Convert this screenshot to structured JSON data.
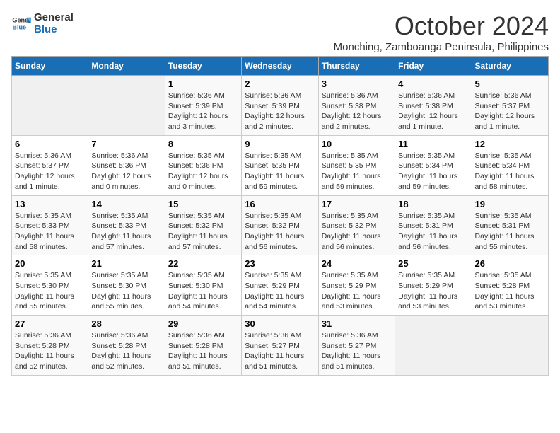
{
  "logo": {
    "line1": "General",
    "line2": "Blue"
  },
  "title": "October 2024",
  "subtitle": "Monching, Zamboanga Peninsula, Philippines",
  "days_of_week": [
    "Sunday",
    "Monday",
    "Tuesday",
    "Wednesday",
    "Thursday",
    "Friday",
    "Saturday"
  ],
  "weeks": [
    [
      {
        "day": "",
        "sunrise": "",
        "sunset": "",
        "daylight": ""
      },
      {
        "day": "",
        "sunrise": "",
        "sunset": "",
        "daylight": ""
      },
      {
        "day": "1",
        "sunrise": "Sunrise: 5:36 AM",
        "sunset": "Sunset: 5:39 PM",
        "daylight": "Daylight: 12 hours and 3 minutes."
      },
      {
        "day": "2",
        "sunrise": "Sunrise: 5:36 AM",
        "sunset": "Sunset: 5:39 PM",
        "daylight": "Daylight: 12 hours and 2 minutes."
      },
      {
        "day": "3",
        "sunrise": "Sunrise: 5:36 AM",
        "sunset": "Sunset: 5:38 PM",
        "daylight": "Daylight: 12 hours and 2 minutes."
      },
      {
        "day": "4",
        "sunrise": "Sunrise: 5:36 AM",
        "sunset": "Sunset: 5:38 PM",
        "daylight": "Daylight: 12 hours and 1 minute."
      },
      {
        "day": "5",
        "sunrise": "Sunrise: 5:36 AM",
        "sunset": "Sunset: 5:37 PM",
        "daylight": "Daylight: 12 hours and 1 minute."
      }
    ],
    [
      {
        "day": "6",
        "sunrise": "Sunrise: 5:36 AM",
        "sunset": "Sunset: 5:37 PM",
        "daylight": "Daylight: 12 hours and 1 minute."
      },
      {
        "day": "7",
        "sunrise": "Sunrise: 5:36 AM",
        "sunset": "Sunset: 5:36 PM",
        "daylight": "Daylight: 12 hours and 0 minutes."
      },
      {
        "day": "8",
        "sunrise": "Sunrise: 5:35 AM",
        "sunset": "Sunset: 5:36 PM",
        "daylight": "Daylight: 12 hours and 0 minutes."
      },
      {
        "day": "9",
        "sunrise": "Sunrise: 5:35 AM",
        "sunset": "Sunset: 5:35 PM",
        "daylight": "Daylight: 11 hours and 59 minutes."
      },
      {
        "day": "10",
        "sunrise": "Sunrise: 5:35 AM",
        "sunset": "Sunset: 5:35 PM",
        "daylight": "Daylight: 11 hours and 59 minutes."
      },
      {
        "day": "11",
        "sunrise": "Sunrise: 5:35 AM",
        "sunset": "Sunset: 5:34 PM",
        "daylight": "Daylight: 11 hours and 59 minutes."
      },
      {
        "day": "12",
        "sunrise": "Sunrise: 5:35 AM",
        "sunset": "Sunset: 5:34 PM",
        "daylight": "Daylight: 11 hours and 58 minutes."
      }
    ],
    [
      {
        "day": "13",
        "sunrise": "Sunrise: 5:35 AM",
        "sunset": "Sunset: 5:33 PM",
        "daylight": "Daylight: 11 hours and 58 minutes."
      },
      {
        "day": "14",
        "sunrise": "Sunrise: 5:35 AM",
        "sunset": "Sunset: 5:33 PM",
        "daylight": "Daylight: 11 hours and 57 minutes."
      },
      {
        "day": "15",
        "sunrise": "Sunrise: 5:35 AM",
        "sunset": "Sunset: 5:32 PM",
        "daylight": "Daylight: 11 hours and 57 minutes."
      },
      {
        "day": "16",
        "sunrise": "Sunrise: 5:35 AM",
        "sunset": "Sunset: 5:32 PM",
        "daylight": "Daylight: 11 hours and 56 minutes."
      },
      {
        "day": "17",
        "sunrise": "Sunrise: 5:35 AM",
        "sunset": "Sunset: 5:32 PM",
        "daylight": "Daylight: 11 hours and 56 minutes."
      },
      {
        "day": "18",
        "sunrise": "Sunrise: 5:35 AM",
        "sunset": "Sunset: 5:31 PM",
        "daylight": "Daylight: 11 hours and 56 minutes."
      },
      {
        "day": "19",
        "sunrise": "Sunrise: 5:35 AM",
        "sunset": "Sunset: 5:31 PM",
        "daylight": "Daylight: 11 hours and 55 minutes."
      }
    ],
    [
      {
        "day": "20",
        "sunrise": "Sunrise: 5:35 AM",
        "sunset": "Sunset: 5:30 PM",
        "daylight": "Daylight: 11 hours and 55 minutes."
      },
      {
        "day": "21",
        "sunrise": "Sunrise: 5:35 AM",
        "sunset": "Sunset: 5:30 PM",
        "daylight": "Daylight: 11 hours and 55 minutes."
      },
      {
        "day": "22",
        "sunrise": "Sunrise: 5:35 AM",
        "sunset": "Sunset: 5:30 PM",
        "daylight": "Daylight: 11 hours and 54 minutes."
      },
      {
        "day": "23",
        "sunrise": "Sunrise: 5:35 AM",
        "sunset": "Sunset: 5:29 PM",
        "daylight": "Daylight: 11 hours and 54 minutes."
      },
      {
        "day": "24",
        "sunrise": "Sunrise: 5:35 AM",
        "sunset": "Sunset: 5:29 PM",
        "daylight": "Daylight: 11 hours and 53 minutes."
      },
      {
        "day": "25",
        "sunrise": "Sunrise: 5:35 AM",
        "sunset": "Sunset: 5:29 PM",
        "daylight": "Daylight: 11 hours and 53 minutes."
      },
      {
        "day": "26",
        "sunrise": "Sunrise: 5:35 AM",
        "sunset": "Sunset: 5:28 PM",
        "daylight": "Daylight: 11 hours and 53 minutes."
      }
    ],
    [
      {
        "day": "27",
        "sunrise": "Sunrise: 5:36 AM",
        "sunset": "Sunset: 5:28 PM",
        "daylight": "Daylight: 11 hours and 52 minutes."
      },
      {
        "day": "28",
        "sunrise": "Sunrise: 5:36 AM",
        "sunset": "Sunset: 5:28 PM",
        "daylight": "Daylight: 11 hours and 52 minutes."
      },
      {
        "day": "29",
        "sunrise": "Sunrise: 5:36 AM",
        "sunset": "Sunset: 5:28 PM",
        "daylight": "Daylight: 11 hours and 51 minutes."
      },
      {
        "day": "30",
        "sunrise": "Sunrise: 5:36 AM",
        "sunset": "Sunset: 5:27 PM",
        "daylight": "Daylight: 11 hours and 51 minutes."
      },
      {
        "day": "31",
        "sunrise": "Sunrise: 5:36 AM",
        "sunset": "Sunset: 5:27 PM",
        "daylight": "Daylight: 11 hours and 51 minutes."
      },
      {
        "day": "",
        "sunrise": "",
        "sunset": "",
        "daylight": ""
      },
      {
        "day": "",
        "sunrise": "",
        "sunset": "",
        "daylight": ""
      }
    ]
  ]
}
